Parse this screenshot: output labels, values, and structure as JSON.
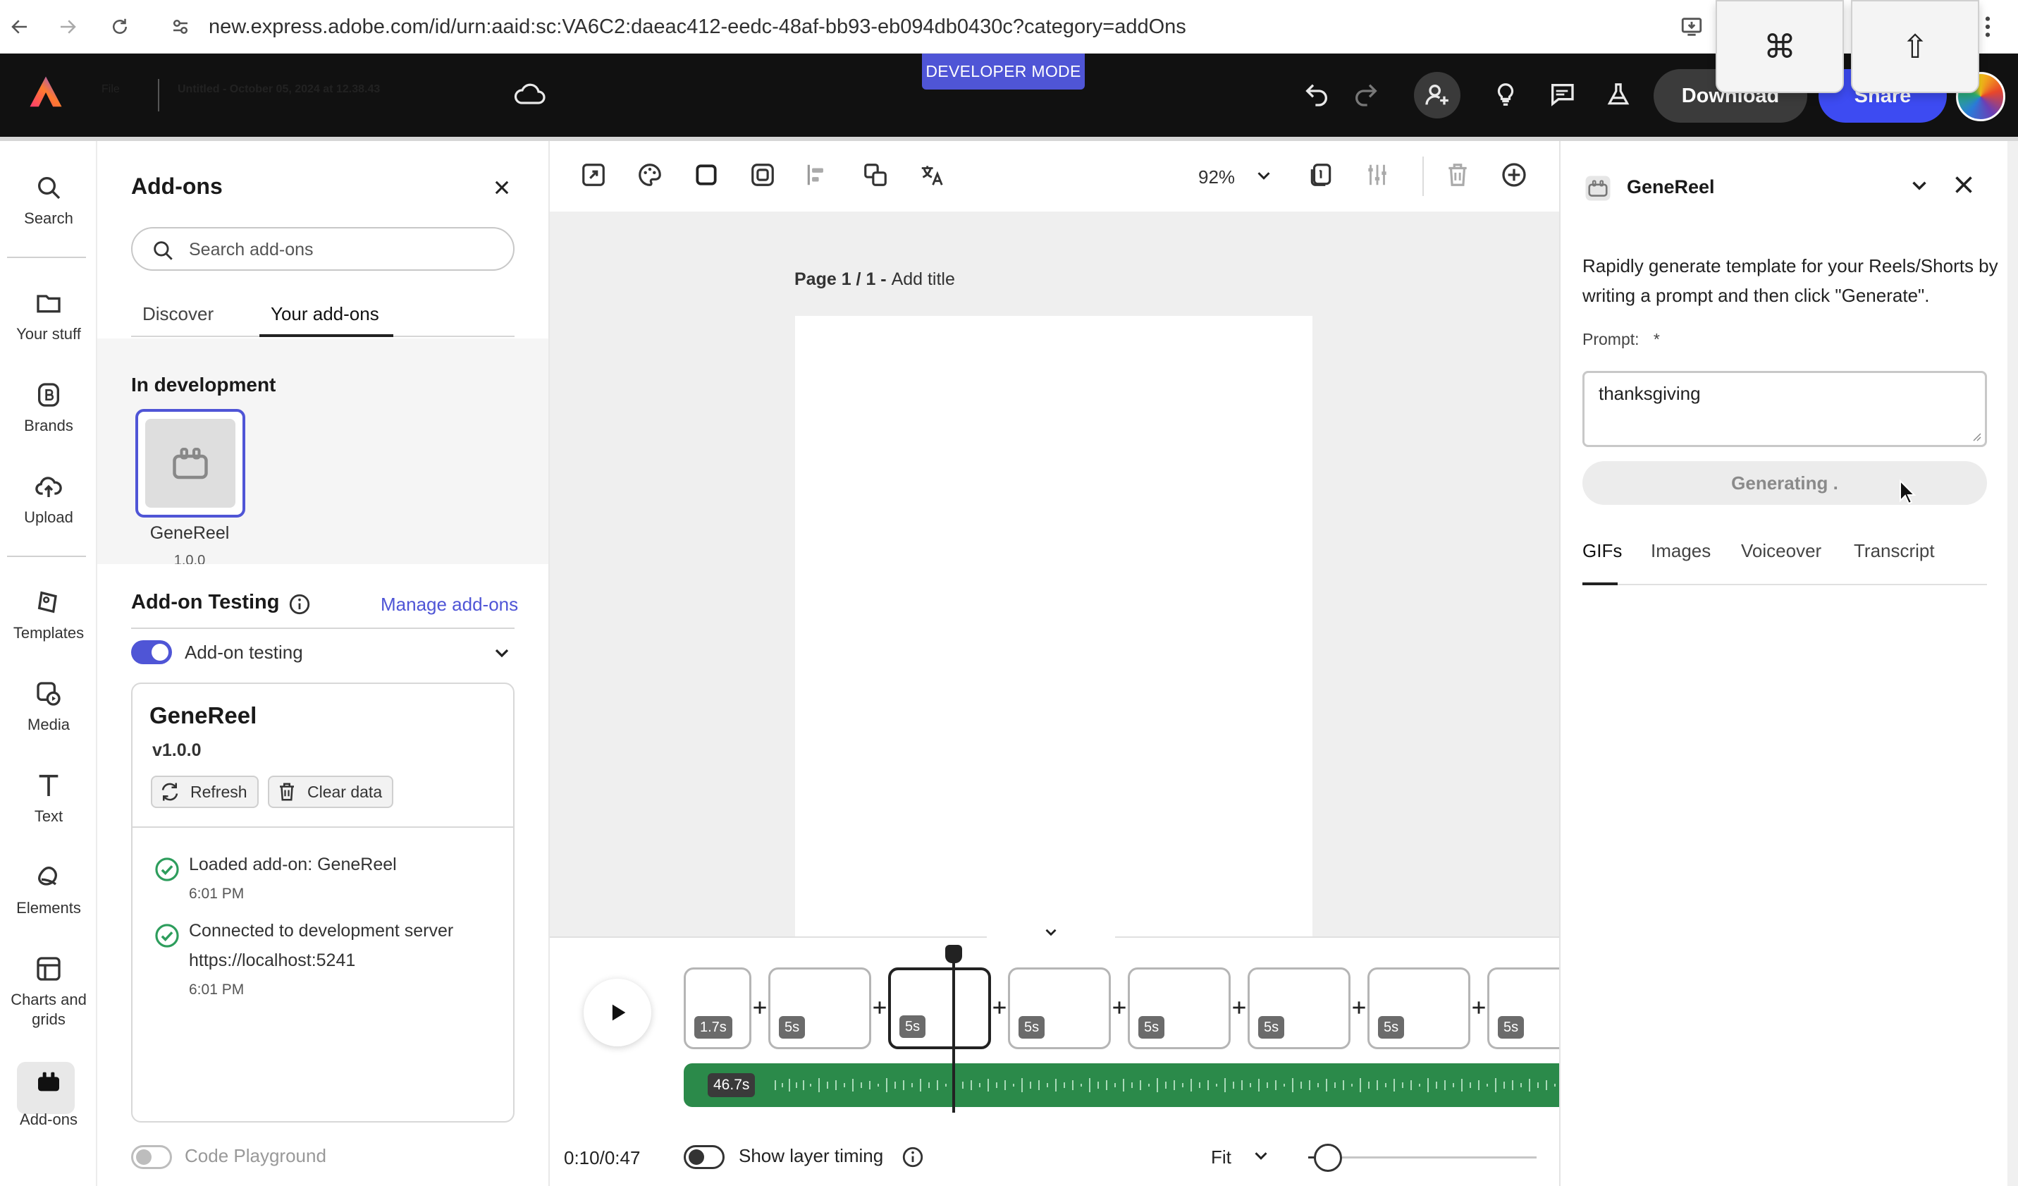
{
  "browser": {
    "url": "new.express.adobe.com/id/urn:aaid:sc:VA6C2:daeac412-eedc-48af-bb93-eb094db0430c?category=addOns",
    "key_overlays": [
      "⌘",
      "⇧"
    ]
  },
  "header": {
    "file_menu": "File",
    "doc_title": "Untitled - October 05, 2024 at 12.38.43",
    "dev_badge": "DEVELOPER MODE",
    "download_label": "Download",
    "share_label": "Share"
  },
  "rail": {
    "items": [
      {
        "label": "Search",
        "icon": "search-icon"
      },
      {
        "label": "Your stuff",
        "icon": "folder-icon"
      },
      {
        "label": "Brands",
        "icon": "brand-icon"
      },
      {
        "label": "Upload",
        "icon": "upload-icon"
      },
      {
        "label": "Templates",
        "icon": "templates-icon"
      },
      {
        "label": "Media",
        "icon": "media-icon"
      },
      {
        "label": "Text",
        "icon": "text-icon"
      },
      {
        "label": "Elements",
        "icon": "elements-icon"
      },
      {
        "label": "Charts and grids",
        "icon": "charts-icon"
      },
      {
        "label": "Add-ons",
        "icon": "addons-icon"
      }
    ]
  },
  "addons": {
    "title": "Add-ons",
    "search_placeholder": "Search add-ons",
    "tabs": [
      "Discover",
      "Your add-ons"
    ],
    "active_tab": "Your add-ons",
    "in_development_title": "In development",
    "tile_name": "GeneReel",
    "tile_version": "1.0.0",
    "testing_title": "Add-on Testing",
    "manage_link": "Manage add-ons",
    "testing_toggle_label": "Add-on testing",
    "testing_toggle_on": true,
    "card": {
      "name": "GeneReel",
      "version": "v1.0.0",
      "refresh_label": "Refresh",
      "clear_label": "Clear data",
      "logs": [
        {
          "text": "Loaded add-on: GeneReel",
          "time": "6:01 PM"
        },
        {
          "text": "Connected to development server",
          "url": "https://localhost:5241",
          "time": "6:01 PM"
        }
      ]
    },
    "playground_label": "Code Playground",
    "playground_on": false
  },
  "toolbar": {
    "zoom": "92%"
  },
  "canvas": {
    "page_label": "Page 1 / 1 - ",
    "add_title": "Add title"
  },
  "timeline": {
    "clips": [
      "1.7s",
      "5s",
      "5s",
      "5s",
      "5s",
      "5s",
      "5s",
      "5s"
    ],
    "active_clip_index": 2,
    "audio_duration": "46.7s",
    "time": "0:10/0:47",
    "layer_timing_label": "Show layer timing",
    "fit_label": "Fit"
  },
  "right_panel": {
    "title": "GeneReel",
    "description": "Rapidly generate template for your Reels/Shorts by writing a prompt and then click \"Generate\".",
    "prompt_label": "Prompt:",
    "prompt_required": "*",
    "prompt_value": "thanksgiving",
    "generate_label": "Generating .",
    "tabs": [
      "GIFs",
      "Images",
      "Voiceover",
      "Transcript"
    ],
    "active_tab": "GIFs"
  },
  "colors": {
    "accent": "#4f55d6",
    "header_bg": "#111111",
    "share": "#3d4bf2",
    "audio_track": "#2b8a4a",
    "success": "#2d9d5c"
  }
}
